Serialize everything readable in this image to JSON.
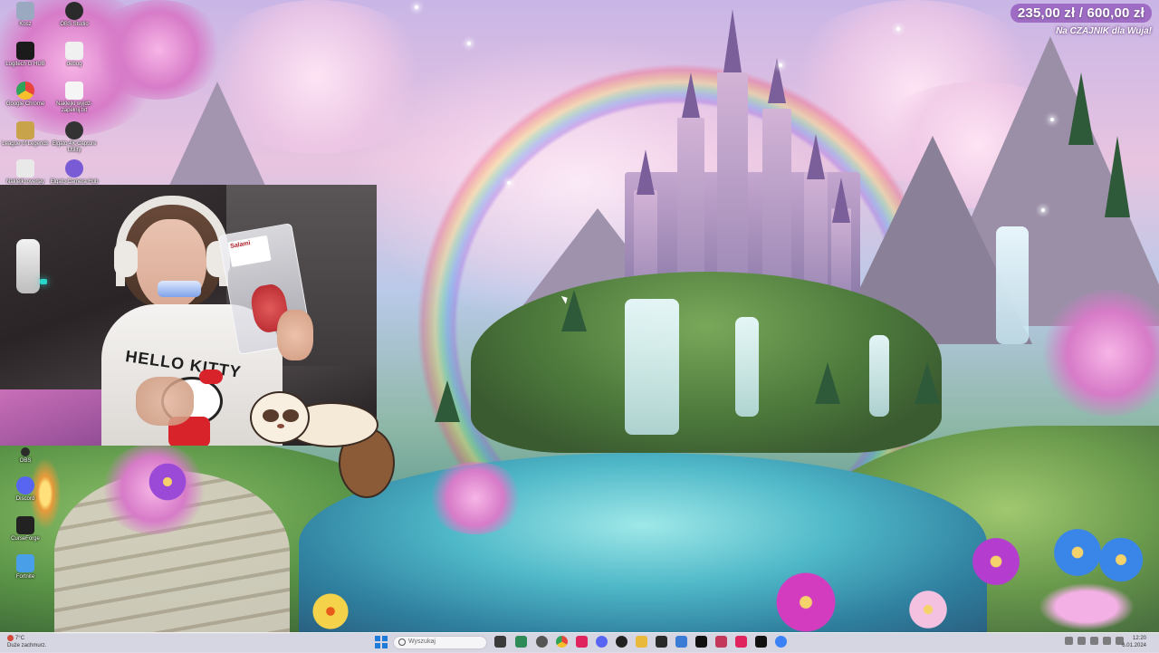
{
  "overlay": {
    "donation_amount": "235,00 zł / 600,00 zł",
    "donation_progress": 0.39,
    "goal_text": "Na CZAJNIK dla Wuja!"
  },
  "desktop_icons_top": [
    {
      "label": "Kosz",
      "icon": "recycle-bin-icon",
      "color": "#9aa8c0"
    },
    {
      "label": "OBS Studio",
      "icon": "obs-icon",
      "color": "#2b2b2b"
    },
    {
      "label": "Logitech G HUB",
      "icon": "logitech-icon",
      "color": "#1b1b1b"
    },
    {
      "label": "debug",
      "icon": "file-icon",
      "color": "#f0f0f0"
    },
    {
      "label": "Google Chrome",
      "icon": "chrome-icon",
      "color": "#e8453c"
    },
    {
      "label": "Naklejki wyjdź-zapełnij.txt",
      "icon": "text-file-icon",
      "color": "#f5f5f5"
    },
    {
      "label": "League of Legends",
      "icon": "league-icon",
      "color": "#c8a34a"
    },
    {
      "label": "Elgato 4K Capture Utility",
      "icon": "elgato-icon",
      "color": "#333333"
    },
    {
      "label": "Naklejki overlay",
      "icon": "overlay-icon",
      "color": "#e9e9e9"
    },
    {
      "label": "Elgato Camera Hub",
      "icon": "camera-hub-icon",
      "color": "#7a5bd6"
    }
  ],
  "desktop_icons_bottom": [
    {
      "label": "OBS",
      "icon": "obs-icon",
      "color": "#2b2b2b"
    },
    {
      "label": "Discord",
      "icon": "discord-icon",
      "color": "#5865f2"
    },
    {
      "label": "CurseForge",
      "icon": "curseforge-icon",
      "color": "#222222"
    },
    {
      "label": "Fortnite",
      "icon": "fortnite-icon",
      "color": "#4aa0e8"
    }
  ],
  "webcam": {
    "shirt_text": "HELLO KITTY",
    "package_label": "Salami"
  },
  "taskbar": {
    "weather_line1": "7°C",
    "weather_line2": "Duże zachmurz.",
    "search_placeholder": "Wyszukaj",
    "clock_time": "12:20",
    "clock_date": "6.01.2024",
    "apps": [
      {
        "name": "files-icon",
        "color": "#3a3a3a"
      },
      {
        "name": "android-icon",
        "color": "#2e8b57"
      },
      {
        "name": "settings-icon",
        "color": "#555555"
      },
      {
        "name": "chrome-icon",
        "color": "#e8453c"
      },
      {
        "name": "tiktok-icon",
        "color": "#e0245e"
      },
      {
        "name": "discord-icon",
        "color": "#5865f2"
      },
      {
        "name": "app-icon",
        "color": "#222222"
      },
      {
        "name": "folder-icon",
        "color": "#e8b93a"
      },
      {
        "name": "terminal-icon",
        "color": "#2a2a2a"
      },
      {
        "name": "photo-icon",
        "color": "#3a7bd5"
      },
      {
        "name": "capcut-icon",
        "color": "#111111"
      },
      {
        "name": "text-icon",
        "color": "#c2375a"
      },
      {
        "name": "tiktok-studio-icon",
        "color": "#e0245e"
      },
      {
        "name": "media-icon",
        "color": "#111111"
      },
      {
        "name": "chrome-alt-icon",
        "color": "#3b82f6"
      }
    ]
  }
}
